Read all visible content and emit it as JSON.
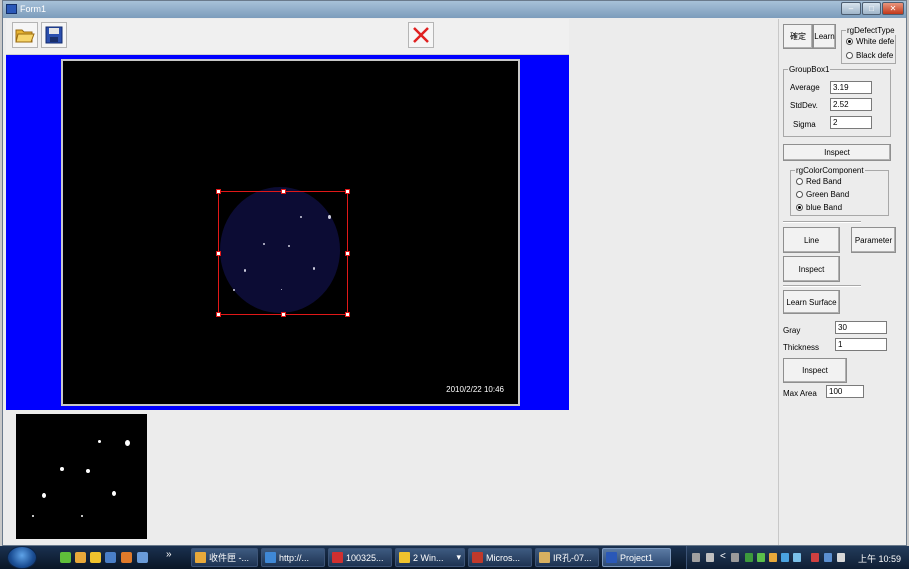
{
  "window": {
    "title": "Form1",
    "minimize_glyph": "–",
    "maximize_glyph": "□",
    "close_glyph": "✕"
  },
  "toolbar": {
    "open_icon": "folder-open-icon",
    "save_icon": "floppy-save-icon",
    "close_icon": "red-x-icon"
  },
  "image_view": {
    "timestamp": "2010/2/22 10:46"
  },
  "right_panel": {
    "confirm_button": "確定",
    "learn_button": "Learn",
    "defect_type": {
      "caption": "rgDefectType",
      "options": [
        "White defe",
        "Black defe"
      ],
      "selected": 0
    },
    "groupbox1": {
      "caption": "GroupBox1",
      "average_label": "Average",
      "average_value": "3.19",
      "stddev_label": "StdDev.",
      "stddev_value": "2.52",
      "sigma_label": "Sigma",
      "sigma_value": "2"
    },
    "inspect_button_1": "Inspect",
    "color_component": {
      "caption": "rgColorComponent",
      "options": [
        "Red Band",
        "Green Band",
        "blue Band"
      ],
      "selected": 2
    },
    "line_button": "Line",
    "parameter_button": "Parameter",
    "inspect_button_2": "Inspect",
    "learn_surface_button": "Learn Surface",
    "gray_label": "Gray",
    "gray_value": "30",
    "thickness_label": "Thickness",
    "thickness_value": "1",
    "inspect_button_3": "Inspect",
    "max_area_label": "Max Area",
    "max_area_value": "100"
  },
  "taskbar": {
    "show_more": "»",
    "tasks": [
      "收件匣 -...",
      "http://...",
      "100325...",
      "2 Win...",
      "Micros...",
      "IR孔-07...",
      "Project1"
    ],
    "win_group_arrow": "▾",
    "tray_expand": "<",
    "clock": "上午 10:59"
  },
  "colors": {
    "accent_blue": "#0000ff",
    "roi_red": "#e01818",
    "taskbar": "#1a3150"
  }
}
